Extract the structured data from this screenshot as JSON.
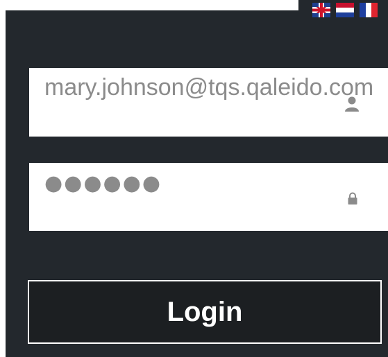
{
  "languages": [
    {
      "code": "en",
      "icon": "uk-flag-icon"
    },
    {
      "code": "nl",
      "icon": "nl-flag-icon"
    },
    {
      "code": "fr",
      "icon": "fr-flag-icon"
    }
  ],
  "login_form": {
    "email_value": "mary.johnson@tqs.qaleido.com",
    "password_masked": "●●●●●●",
    "user_icon": "user-icon",
    "lock_icon": "lock-icon",
    "login_label": "Login"
  },
  "colors": {
    "panel_bg": "#23282d",
    "button_bg": "#1c1f22",
    "field_text": "#8b8b8b"
  }
}
